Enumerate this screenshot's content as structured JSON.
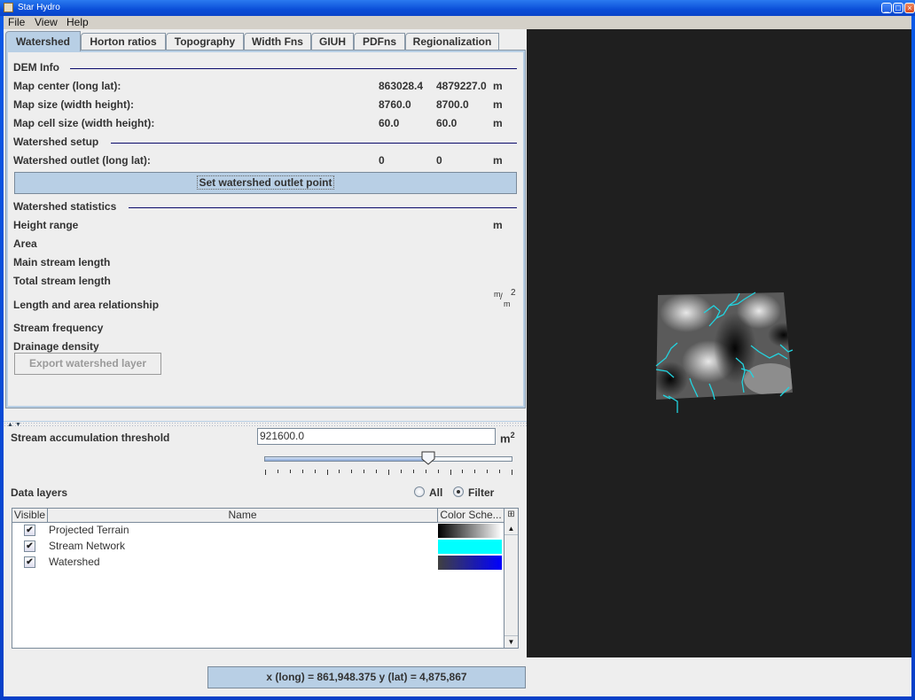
{
  "window": {
    "title": "Star Hydro",
    "controls": [
      "minimize",
      "maximize",
      "close"
    ]
  },
  "menu": [
    "File",
    "View",
    "Help"
  ],
  "tabs": [
    {
      "label": "Watershed",
      "active": true
    },
    {
      "label": "Horton ratios"
    },
    {
      "label": "Topography"
    },
    {
      "label": "Width Fns"
    },
    {
      "label": "GIUH"
    },
    {
      "label": "PDFns"
    },
    {
      "label": "Regionalization"
    }
  ],
  "dem_info": {
    "header": "DEM Info",
    "rows": [
      {
        "label": "Map center (long lat):",
        "v1": "863028.4",
        "v2": "4879227.0",
        "unit": "m"
      },
      {
        "label": "Map size (width height):",
        "v1": "8760.0",
        "v2": "8700.0",
        "unit": "m"
      },
      {
        "label": "Map cell size (width height):",
        "v1": "60.0",
        "v2": "60.0",
        "unit": "m"
      }
    ]
  },
  "watershed_setup": {
    "header": "Watershed setup",
    "outlet": {
      "label": "Watershed outlet (long lat):",
      "v1": "0",
      "v2": "0",
      "unit": "m"
    },
    "set_button": "Set watershed outlet point"
  },
  "watershed_statistics": {
    "header": "Watershed statistics",
    "rows": [
      {
        "label": "Height range",
        "unit": "m"
      },
      {
        "label": "Area",
        "unit": ""
      },
      {
        "label": "Main stream length",
        "unit": ""
      },
      {
        "label": "Total stream length",
        "unit": ""
      },
      {
        "label": "Length and area relationship",
        "unit_num": "m",
        "unit_den": "m",
        "unit_exp": "2"
      },
      {
        "label": "Stream frequency",
        "unit": ""
      },
      {
        "label": "Drainage density",
        "unit": ""
      }
    ],
    "export_button": "Export watershed layer"
  },
  "threshold": {
    "label": "Stream accumulation threshold",
    "value": "921600.0",
    "unit": "m",
    "unit_exp": "2",
    "slider_fraction": 0.66
  },
  "data_layers": {
    "label": "Data layers",
    "radio_all": "All",
    "radio_filter": "Filter",
    "selected": "Filter",
    "columns": [
      "Visible",
      "Name",
      "Color Sche..."
    ],
    "rows": [
      {
        "visible": true,
        "name": "Projected Terrain",
        "colors": [
          "#000000",
          "#ffffff"
        ]
      },
      {
        "visible": true,
        "name": "Stream Network",
        "colors": [
          "#00ffff",
          "#00ffff"
        ]
      },
      {
        "visible": true,
        "name": "Watershed",
        "colors": [
          "#404040",
          "#0000ff"
        ]
      }
    ]
  },
  "status": {
    "coordinates": "x (long) = 861,948.375 y (lat) = 4,875,867"
  },
  "colors": {
    "accent": "#b8cfe5",
    "viewport_bg": "#1f1f1f",
    "stream": "#22d4e0"
  }
}
